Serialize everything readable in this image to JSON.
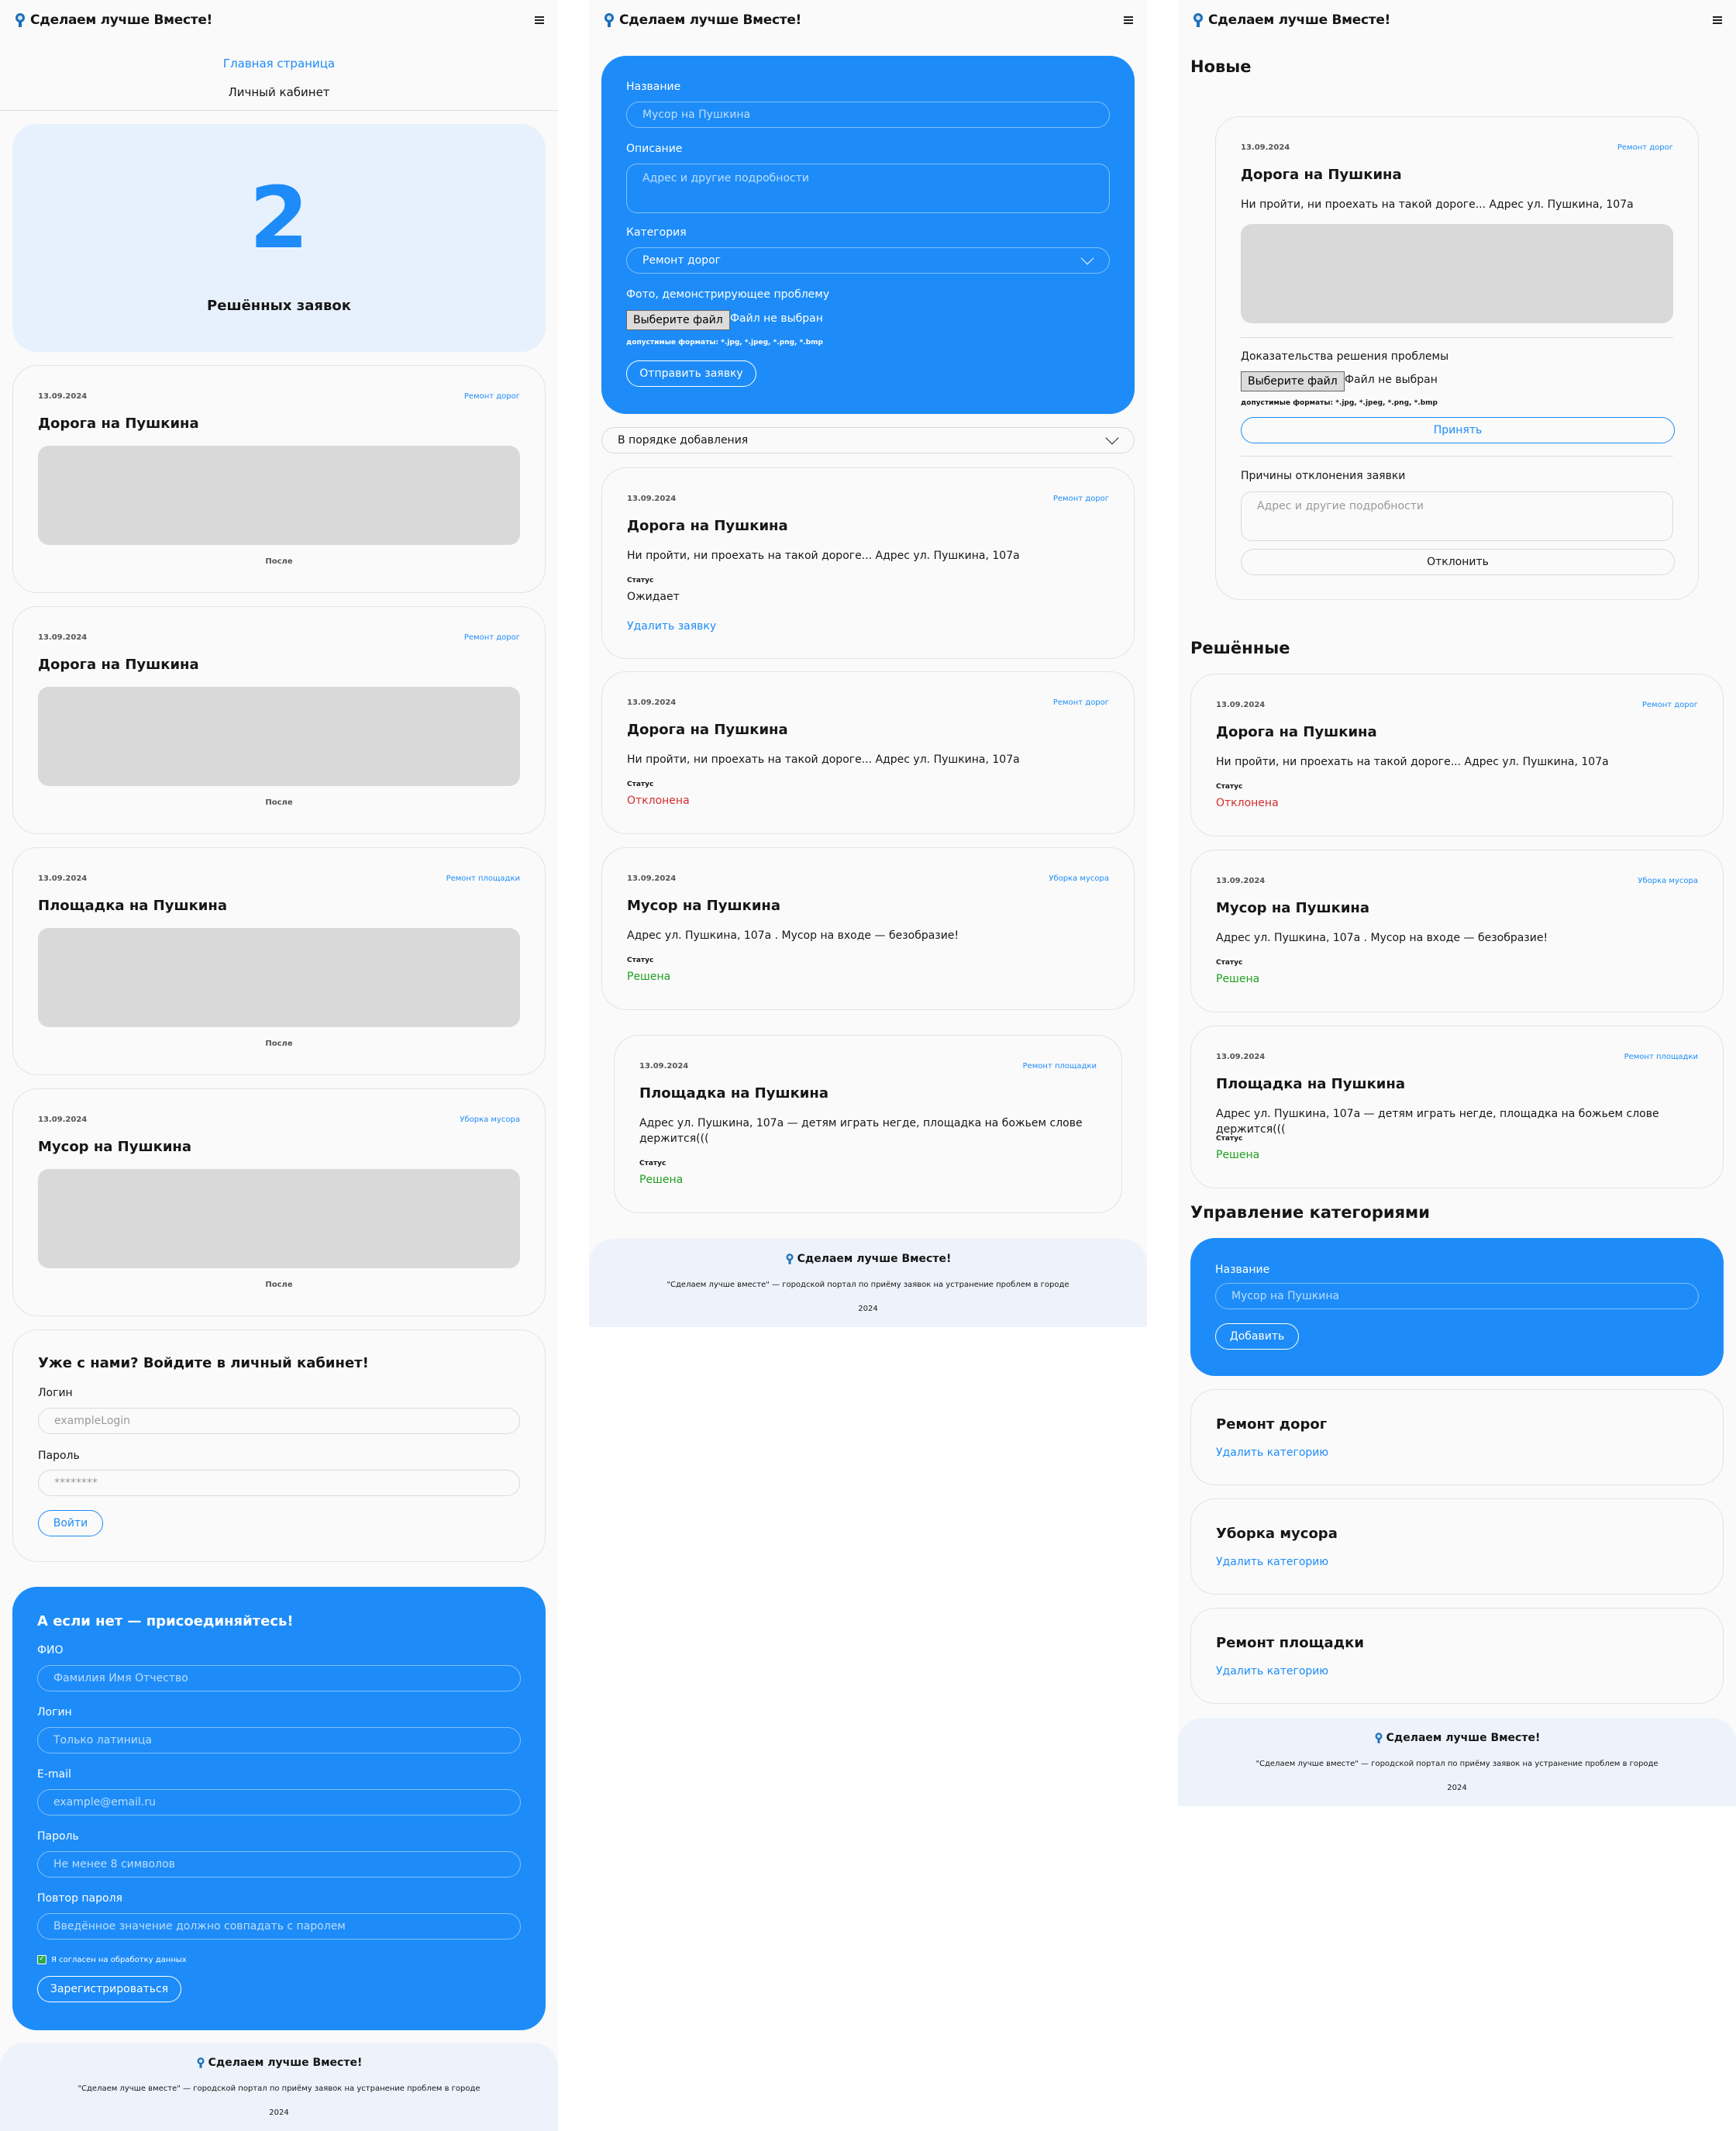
{
  "app": {
    "logo_text": "Сделаем лучше Вместе!",
    "menu_icon": "hamburger-icon",
    "brand_color": "#1d8cf8",
    "success_color": "#1f9d1f",
    "danger_color": "#d12c2c"
  },
  "nav": {
    "home": "Главная страница",
    "cabinet": "Личный кабинет"
  },
  "stats": {
    "number": "2",
    "label": "Решённых заявок"
  },
  "labels": {
    "after": "После",
    "status": "Статус",
    "formats": "допустимые форматы: *.jpg, *.jpeg, *.png, *.bmp",
    "choose_file": "Выберите файл",
    "no_file": "Файл не выбран",
    "delete_request": "Удалить заявку",
    "delete_category": "Удалить категорию"
  },
  "solved_cards": [
    {
      "date": "13.09.2024",
      "category": "Ремонт дорог",
      "title": "Дорога на Пушкина"
    },
    {
      "date": "13.09.2024",
      "category": "Ремонт дорог",
      "title": "Дорога на Пушкина"
    },
    {
      "date": "13.09.2024",
      "category": "Ремонт площадки",
      "title": "Площадка на Пушкина"
    },
    {
      "date": "13.09.2024",
      "category": "Уборка мусора",
      "title": "Мусор на Пушкина"
    }
  ],
  "login": {
    "title": "Уже с нами? Войдите в личный кабинет!",
    "login_label": "Логин",
    "login_placeholder": "exampleLogin",
    "password_label": "Пароль",
    "password_placeholder": "********",
    "submit": "Войти"
  },
  "register": {
    "title": "А если нет — присоединяйтесь!",
    "fields": [
      {
        "label": "ФИО",
        "placeholder": "Фамилия Имя Отчество"
      },
      {
        "label": "Логин",
        "placeholder": "Только латиница"
      },
      {
        "label": "E-mail",
        "placeholder": "example@email.ru"
      },
      {
        "label": "Пароль",
        "placeholder": "Не менее 8 символов"
      },
      {
        "label": "Повтор пароля",
        "placeholder": "Введённое значение должно совпадать с паролем"
      }
    ],
    "consent": "Я согласен на обработку данных",
    "consent_checked": true,
    "submit": "Зарегистрироваться"
  },
  "footer": {
    "description": "\"Сделаем лучше вместе\" — городской портал по приёму заявок на устранение проблем в городе",
    "year": "2024"
  },
  "new_request": {
    "name_label": "Название",
    "name_placeholder": "Мусор на Пушкина",
    "desc_label": "Описание",
    "desc_placeholder": "Адрес и другие подробности",
    "category_label": "Категория",
    "category_value": "Ремонт дорог",
    "photo_label": "Фото, демонстрирующее проблему",
    "submit": "Отправить заявку"
  },
  "sort": {
    "value": "В порядке добавления"
  },
  "my_requests": [
    {
      "date": "13.09.2024",
      "category": "Ремонт дорог",
      "title": "Дорога на Пушкина",
      "description": "Ни пройти, ни проехать на такой дороге... Адрес ул. Пушкина, 107а",
      "status": "Ожидает"
    },
    {
      "date": "13.09.2024",
      "category": "Ремонт дорог",
      "title": "Дорога на Пушкина",
      "description": "Ни пройти, ни проехать на такой дороге... Адрес ул. Пушкина, 107а",
      "status": "Отклонена"
    },
    {
      "date": "13.09.2024",
      "category": "Уборка мусора",
      "title": "Мусор на Пушкина",
      "description": "Адрес ул. Пушкина, 107а . Мусор на входе — безобразие!",
      "status": "Решена"
    },
    {
      "date": "13.09.2024",
      "category": "Ремонт площадки",
      "title": "Площадка на Пушкина",
      "description": "Адрес ул. Пушкина, 107а — детям играть негде, площадка на божьем слове держится(((",
      "status": "Решена"
    }
  ],
  "admin": {
    "new_title": "Новые",
    "new_card": {
      "date": "13.09.2024",
      "category": "Ремонт дорог",
      "title": "Дорога на Пушкина",
      "description": "Ни пройти, ни проехать на такой дороге... Адрес ул. Пушкина, 107а",
      "proof_label": "Доказательства решения проблемы",
      "accept": "Принять",
      "reject_label": "Причины отклонения заявки",
      "reject_placeholder": "Адрес и другие подробности",
      "reject": "Отклонить"
    },
    "solved_title": "Решённые",
    "solved": [
      {
        "date": "13.09.2024",
        "category": "Ремонт дорог",
        "title": "Дорога на Пушкина",
        "description": "Ни пройти, ни проехать на такой дороге... Адрес ул. Пушкина, 107а",
        "status": "Отклонена"
      },
      {
        "date": "13.09.2024",
        "category": "Уборка мусора",
        "title": "Мусор на Пушкина",
        "description": "Адрес ул. Пушкина, 107а . Мусор на входе — безобразие!",
        "status": "Решена"
      },
      {
        "date": "13.09.2024",
        "category": "Ремонт площадки",
        "title": "Площадка на Пушкина",
        "description": "Адрес ул. Пушкина, 107а — детям играть негде, площадка на божьем слове держится(((",
        "status": "Решена"
      }
    ],
    "categories_title": "Управление категориями",
    "cat_form": {
      "name_label": "Название",
      "name_placeholder": "Мусор на Пушкина",
      "submit": "Добавить"
    },
    "categories": [
      "Ремонт дорог",
      "Уборка мусора",
      "Ремонт площадки"
    ]
  }
}
